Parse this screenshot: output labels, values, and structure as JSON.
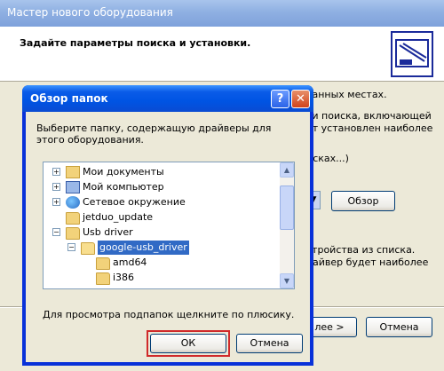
{
  "wizard": {
    "title": "Мастер нового оборудования",
    "heading": "Задайте параметры поиска и установки.",
    "partial_text": [
      "ванных местах.",
      "ти поиска, включающей",
      "ет установлен наиболее",
      "нсках...)",
      "стройства из списка.",
      "райвер будет наиболее"
    ],
    "browse_label": "Обзор",
    "next_label": "лее >",
    "cancel_label": "Отмена"
  },
  "dialog": {
    "title": "Обзор папок",
    "help_label": "?",
    "close_label": "✕",
    "description": "Выберите папку, содержащую драйверы для этого оборудования.",
    "tree": [
      {
        "label": "Мои документы",
        "icon": "documents-icon",
        "expander": "+"
      },
      {
        "label": "Мой компьютер",
        "icon": "computer-icon",
        "expander": "+"
      },
      {
        "label": "Сетевое окружение",
        "icon": "network-icon",
        "expander": "+"
      },
      {
        "label": "jetduo_update",
        "icon": "folder-icon",
        "expander": ""
      },
      {
        "label": "Usb driver",
        "icon": "folder-icon",
        "expander": "−"
      },
      {
        "label": "google-usb_driver",
        "icon": "folder-open-icon",
        "expander": "−",
        "selected": true
      },
      {
        "label": "amd64",
        "icon": "folder-icon",
        "expander": ""
      },
      {
        "label": "i386",
        "icon": "folder-icon",
        "expander": ""
      }
    ],
    "hint": "Для просмотра подпапок щелкните по плюсику.",
    "ok_label": "ОК",
    "cancel_label": "Отмена"
  },
  "colors": {
    "highlight": "#d02a2a",
    "selection": "#316ac5",
    "title_bar": "#0054e3"
  }
}
